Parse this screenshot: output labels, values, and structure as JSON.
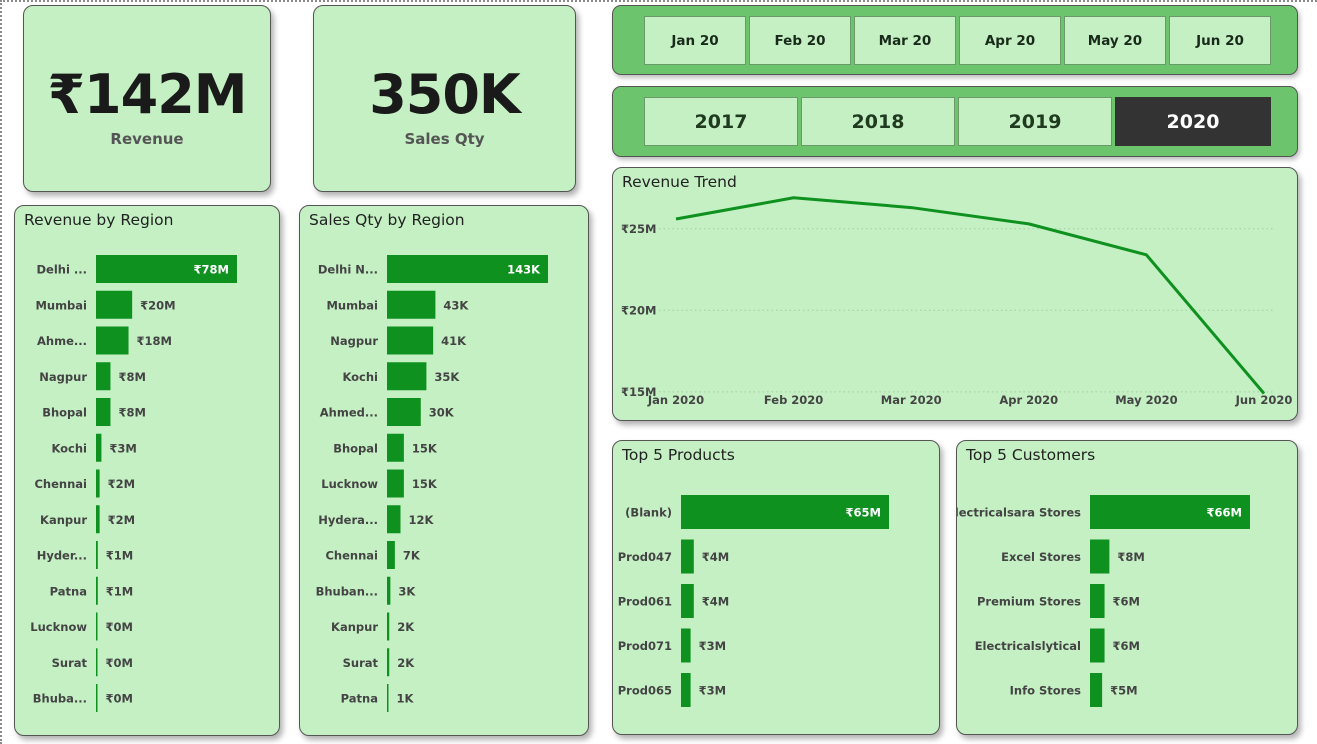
{
  "colors": {
    "card_bg": "#c4f0c4",
    "slicer_bg": "#6cc46c",
    "bar": "#0f9120",
    "selected_bg": "#333333",
    "label_text": "#444444"
  },
  "kpis": {
    "revenue": {
      "value": "₹142M",
      "label": "Revenue"
    },
    "sales_qty": {
      "value": "350K",
      "label": "Sales Qty"
    }
  },
  "month_slicer": {
    "items": [
      "Jan 20",
      "Feb 20",
      "Mar 20",
      "Apr 20",
      "May 20",
      "Jun 20"
    ]
  },
  "year_slicer": {
    "items": [
      "2017",
      "2018",
      "2019",
      "2020"
    ],
    "selected": "2020"
  },
  "revenue_by_region": {
    "title": "Revenue by Region"
  },
  "sales_qty_by_region": {
    "title": "Sales Qty by Region"
  },
  "revenue_trend": {
    "title": "Revenue Trend"
  },
  "top_products": {
    "title": "Top 5 Products"
  },
  "top_customers": {
    "title": "Top 5 Customers"
  },
  "chart_data": [
    {
      "id": "revenue_by_region",
      "type": "bar",
      "orientation": "horizontal",
      "title": "Revenue by Region",
      "categories": [
        "Delhi ...",
        "Mumbai",
        "Ahme...",
        "Nagpur",
        "Bhopal",
        "Kochi",
        "Chennai",
        "Kanpur",
        "Hyder...",
        "Patna",
        "Lucknow",
        "Surat",
        "Bhuba..."
      ],
      "values": [
        78,
        20,
        18,
        8,
        8,
        3,
        2,
        2,
        1,
        1,
        0,
        0,
        0
      ],
      "labels": [
        "₹78M",
        "₹20M",
        "₹18M",
        "₹8M",
        "₹8M",
        "₹3M",
        "₹2M",
        "₹2M",
        "₹1M",
        "₹1M",
        "₹0M",
        "₹0M",
        "₹0M"
      ],
      "unit": "₹M",
      "grid": false
    },
    {
      "id": "sales_qty_by_region",
      "type": "bar",
      "orientation": "horizontal",
      "title": "Sales Qty by Region",
      "categories": [
        "Delhi N...",
        "Mumbai",
        "Nagpur",
        "Kochi",
        "Ahmed...",
        "Bhopal",
        "Lucknow",
        "Hydera...",
        "Chennai",
        "Bhuban...",
        "Kanpur",
        "Surat",
        "Patna"
      ],
      "values": [
        143,
        43,
        41,
        35,
        30,
        15,
        15,
        12,
        7,
        3,
        2,
        2,
        1
      ],
      "labels": [
        "143K",
        "43K",
        "41K",
        "35K",
        "30K",
        "15K",
        "15K",
        "12K",
        "7K",
        "3K",
        "2K",
        "2K",
        "1K"
      ],
      "unit": "K",
      "grid": false
    },
    {
      "id": "revenue_trend",
      "type": "line",
      "title": "Revenue Trend",
      "x": [
        "Jan 2020",
        "Feb 2020",
        "Mar 2020",
        "Apr 2020",
        "May 2020",
        "Jun 2020"
      ],
      "series": [
        {
          "values": [
            25.6,
            26.9,
            26.3,
            25.3,
            23.4,
            14.9
          ]
        }
      ],
      "yticks": [
        15,
        20,
        25
      ],
      "ytick_labels": [
        "₹15M",
        "₹20M",
        "₹25M"
      ],
      "ylim": [
        14.5,
        27.5
      ],
      "unit": "₹M",
      "grid": true
    },
    {
      "id": "top_products",
      "type": "bar",
      "orientation": "horizontal",
      "title": "Top 5 Products",
      "categories": [
        "(Blank)",
        "Prod047",
        "Prod061",
        "Prod071",
        "Prod065"
      ],
      "values": [
        65,
        4,
        4,
        3,
        3
      ],
      "labels": [
        "₹65M",
        "₹4M",
        "₹4M",
        "₹3M",
        "₹3M"
      ],
      "unit": "₹M",
      "grid": false
    },
    {
      "id": "top_customers",
      "type": "bar",
      "orientation": "horizontal",
      "title": "Top 5 Customers",
      "categories": [
        "Electricalsara Stores",
        "Excel Stores",
        "Premium Stores",
        "Electricalslytical",
        "Info Stores"
      ],
      "values": [
        66,
        8,
        6,
        6,
        5
      ],
      "labels": [
        "₹66M",
        "₹8M",
        "₹6M",
        "₹6M",
        "₹5M"
      ],
      "unit": "₹M",
      "grid": false
    }
  ]
}
